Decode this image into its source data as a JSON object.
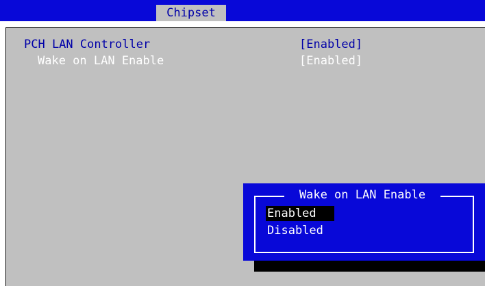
{
  "header": {
    "tabs": [
      {
        "label": "Chipset",
        "selected": true
      }
    ]
  },
  "settings": [
    {
      "label": "PCH LAN Controller",
      "value": "[Enabled]",
      "selected": false
    },
    {
      "label": "Wake on LAN Enable",
      "value": "[Enabled]",
      "selected": true
    }
  ],
  "popup": {
    "title": "Wake on LAN Enable",
    "options": [
      {
        "label": "Enabled",
        "highlighted": true
      },
      {
        "label": "Disabled",
        "highlighted": false
      }
    ]
  },
  "colors": {
    "header_bg": "#0808d8",
    "panel_bg": "#c0c0c0",
    "label_text": "#0000a8",
    "selected_text": "#ffffff",
    "popup_bg": "#0808d8",
    "highlight_bg": "#000000"
  }
}
